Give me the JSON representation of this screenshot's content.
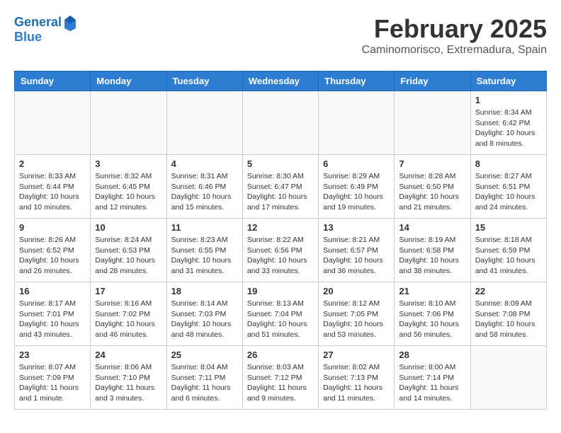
{
  "logo": {
    "line1": "General",
    "line2": "Blue"
  },
  "title": {
    "month_year": "February 2025",
    "location": "Caminomorisco, Extremadura, Spain"
  },
  "days_of_week": [
    "Sunday",
    "Monday",
    "Tuesday",
    "Wednesday",
    "Thursday",
    "Friday",
    "Saturday"
  ],
  "weeks": [
    [
      {
        "day": "",
        "content": ""
      },
      {
        "day": "",
        "content": ""
      },
      {
        "day": "",
        "content": ""
      },
      {
        "day": "",
        "content": ""
      },
      {
        "day": "",
        "content": ""
      },
      {
        "day": "",
        "content": ""
      },
      {
        "day": "1",
        "content": "Sunrise: 8:34 AM\nSunset: 6:42 PM\nDaylight: 10 hours and 8 minutes."
      }
    ],
    [
      {
        "day": "2",
        "content": "Sunrise: 8:33 AM\nSunset: 6:44 PM\nDaylight: 10 hours and 10 minutes."
      },
      {
        "day": "3",
        "content": "Sunrise: 8:32 AM\nSunset: 6:45 PM\nDaylight: 10 hours and 12 minutes."
      },
      {
        "day": "4",
        "content": "Sunrise: 8:31 AM\nSunset: 6:46 PM\nDaylight: 10 hours and 15 minutes."
      },
      {
        "day": "5",
        "content": "Sunrise: 8:30 AM\nSunset: 6:47 PM\nDaylight: 10 hours and 17 minutes."
      },
      {
        "day": "6",
        "content": "Sunrise: 8:29 AM\nSunset: 6:49 PM\nDaylight: 10 hours and 19 minutes."
      },
      {
        "day": "7",
        "content": "Sunrise: 8:28 AM\nSunset: 6:50 PM\nDaylight: 10 hours and 21 minutes."
      },
      {
        "day": "8",
        "content": "Sunrise: 8:27 AM\nSunset: 6:51 PM\nDaylight: 10 hours and 24 minutes."
      }
    ],
    [
      {
        "day": "9",
        "content": "Sunrise: 8:26 AM\nSunset: 6:52 PM\nDaylight: 10 hours and 26 minutes."
      },
      {
        "day": "10",
        "content": "Sunrise: 8:24 AM\nSunset: 6:53 PM\nDaylight: 10 hours and 28 minutes."
      },
      {
        "day": "11",
        "content": "Sunrise: 8:23 AM\nSunset: 6:55 PM\nDaylight: 10 hours and 31 minutes."
      },
      {
        "day": "12",
        "content": "Sunrise: 8:22 AM\nSunset: 6:56 PM\nDaylight: 10 hours and 33 minutes."
      },
      {
        "day": "13",
        "content": "Sunrise: 8:21 AM\nSunset: 6:57 PM\nDaylight: 10 hours and 36 minutes."
      },
      {
        "day": "14",
        "content": "Sunrise: 8:19 AM\nSunset: 6:58 PM\nDaylight: 10 hours and 38 minutes."
      },
      {
        "day": "15",
        "content": "Sunrise: 8:18 AM\nSunset: 6:59 PM\nDaylight: 10 hours and 41 minutes."
      }
    ],
    [
      {
        "day": "16",
        "content": "Sunrise: 8:17 AM\nSunset: 7:01 PM\nDaylight: 10 hours and 43 minutes."
      },
      {
        "day": "17",
        "content": "Sunrise: 8:16 AM\nSunset: 7:02 PM\nDaylight: 10 hours and 46 minutes."
      },
      {
        "day": "18",
        "content": "Sunrise: 8:14 AM\nSunset: 7:03 PM\nDaylight: 10 hours and 48 minutes."
      },
      {
        "day": "19",
        "content": "Sunrise: 8:13 AM\nSunset: 7:04 PM\nDaylight: 10 hours and 51 minutes."
      },
      {
        "day": "20",
        "content": "Sunrise: 8:12 AM\nSunset: 7:05 PM\nDaylight: 10 hours and 53 minutes."
      },
      {
        "day": "21",
        "content": "Sunrise: 8:10 AM\nSunset: 7:06 PM\nDaylight: 10 hours and 56 minutes."
      },
      {
        "day": "22",
        "content": "Sunrise: 8:09 AM\nSunset: 7:08 PM\nDaylight: 10 hours and 58 minutes."
      }
    ],
    [
      {
        "day": "23",
        "content": "Sunrise: 8:07 AM\nSunset: 7:09 PM\nDaylight: 11 hours and 1 minute."
      },
      {
        "day": "24",
        "content": "Sunrise: 8:06 AM\nSunset: 7:10 PM\nDaylight: 11 hours and 3 minutes."
      },
      {
        "day": "25",
        "content": "Sunrise: 8:04 AM\nSunset: 7:11 PM\nDaylight: 11 hours and 6 minutes."
      },
      {
        "day": "26",
        "content": "Sunrise: 8:03 AM\nSunset: 7:12 PM\nDaylight: 11 hours and 9 minutes."
      },
      {
        "day": "27",
        "content": "Sunrise: 8:02 AM\nSunset: 7:13 PM\nDaylight: 11 hours and 11 minutes."
      },
      {
        "day": "28",
        "content": "Sunrise: 8:00 AM\nSunset: 7:14 PM\nDaylight: 11 hours and 14 minutes."
      },
      {
        "day": "",
        "content": ""
      }
    ]
  ]
}
